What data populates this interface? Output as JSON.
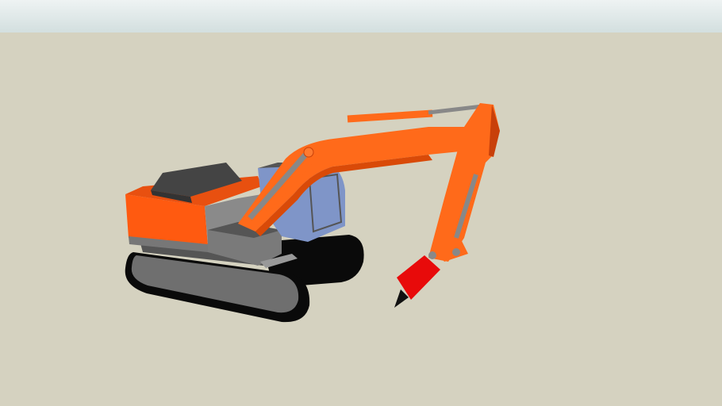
{
  "scene": {
    "subject": "excavator-3d-model",
    "colors": {
      "sky_top": "#e6eeee",
      "sky_bottom": "#cfdcdc",
      "ground": "#d5d2c0",
      "body_orange": "#ff5a10",
      "body_orange_dark": "#e04a08",
      "boom_orange": "#ff6a1a",
      "metal_gray": "#7a7a7a",
      "dark_gray": "#4a4a4a",
      "track_black": "#0a0a0a",
      "cab_glass": "#7f95c8",
      "breaker_red": "#e80a0a"
    }
  }
}
